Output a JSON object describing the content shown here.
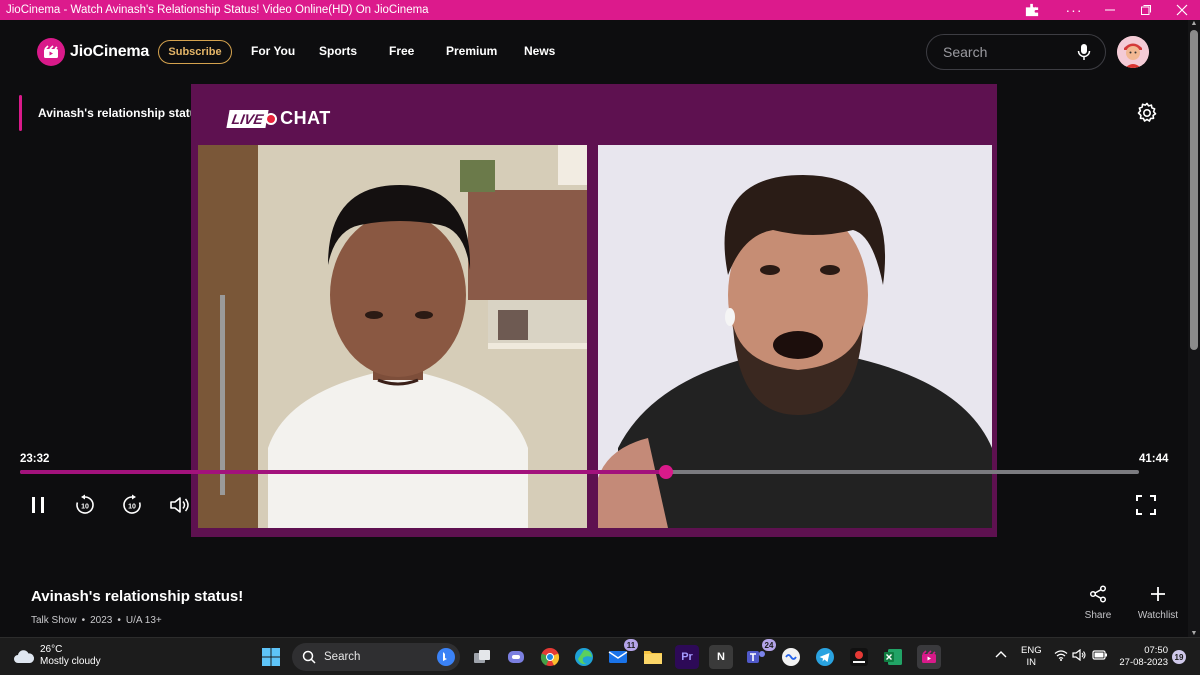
{
  "window": {
    "title": "JioCinema - Watch Avinash's Relationship Status! Video Online(HD) On JioCinema"
  },
  "brand": {
    "name": "JioCinema",
    "accent": "#d91a8a",
    "subscribe_color": "#e4b568"
  },
  "nav": {
    "subscribe_label": "Subscribe",
    "links": [
      "For You",
      "Sports",
      "Free",
      "Premium",
      "News"
    ],
    "search_placeholder": "Search"
  },
  "player": {
    "episode_label": "Avinash's relationship status!",
    "overlay_live": "LIVE",
    "overlay_chat": "CHAT",
    "elapsed": "23:32",
    "remaining": "41:44",
    "progress_fraction": 0.577,
    "skip_back_label": "10",
    "skip_forward_label": "10"
  },
  "show": {
    "title": "Avinash's relationship status!",
    "genre": "Talk Show",
    "year": "2023",
    "rating": "U/A 13+",
    "share_label": "Share",
    "watchlist_label": "Watchlist"
  },
  "taskbar": {
    "temperature": "26°C",
    "condition": "Mostly cloudy",
    "search_placeholder": "Search",
    "badges": {
      "mail": "11",
      "teams": "24"
    },
    "apps": {
      "premiere": "Pr",
      "notion": "N"
    },
    "language_top": "ENG",
    "language_bottom": "IN",
    "time": "07:50",
    "date": "27-08-2023",
    "notifications": "19"
  }
}
